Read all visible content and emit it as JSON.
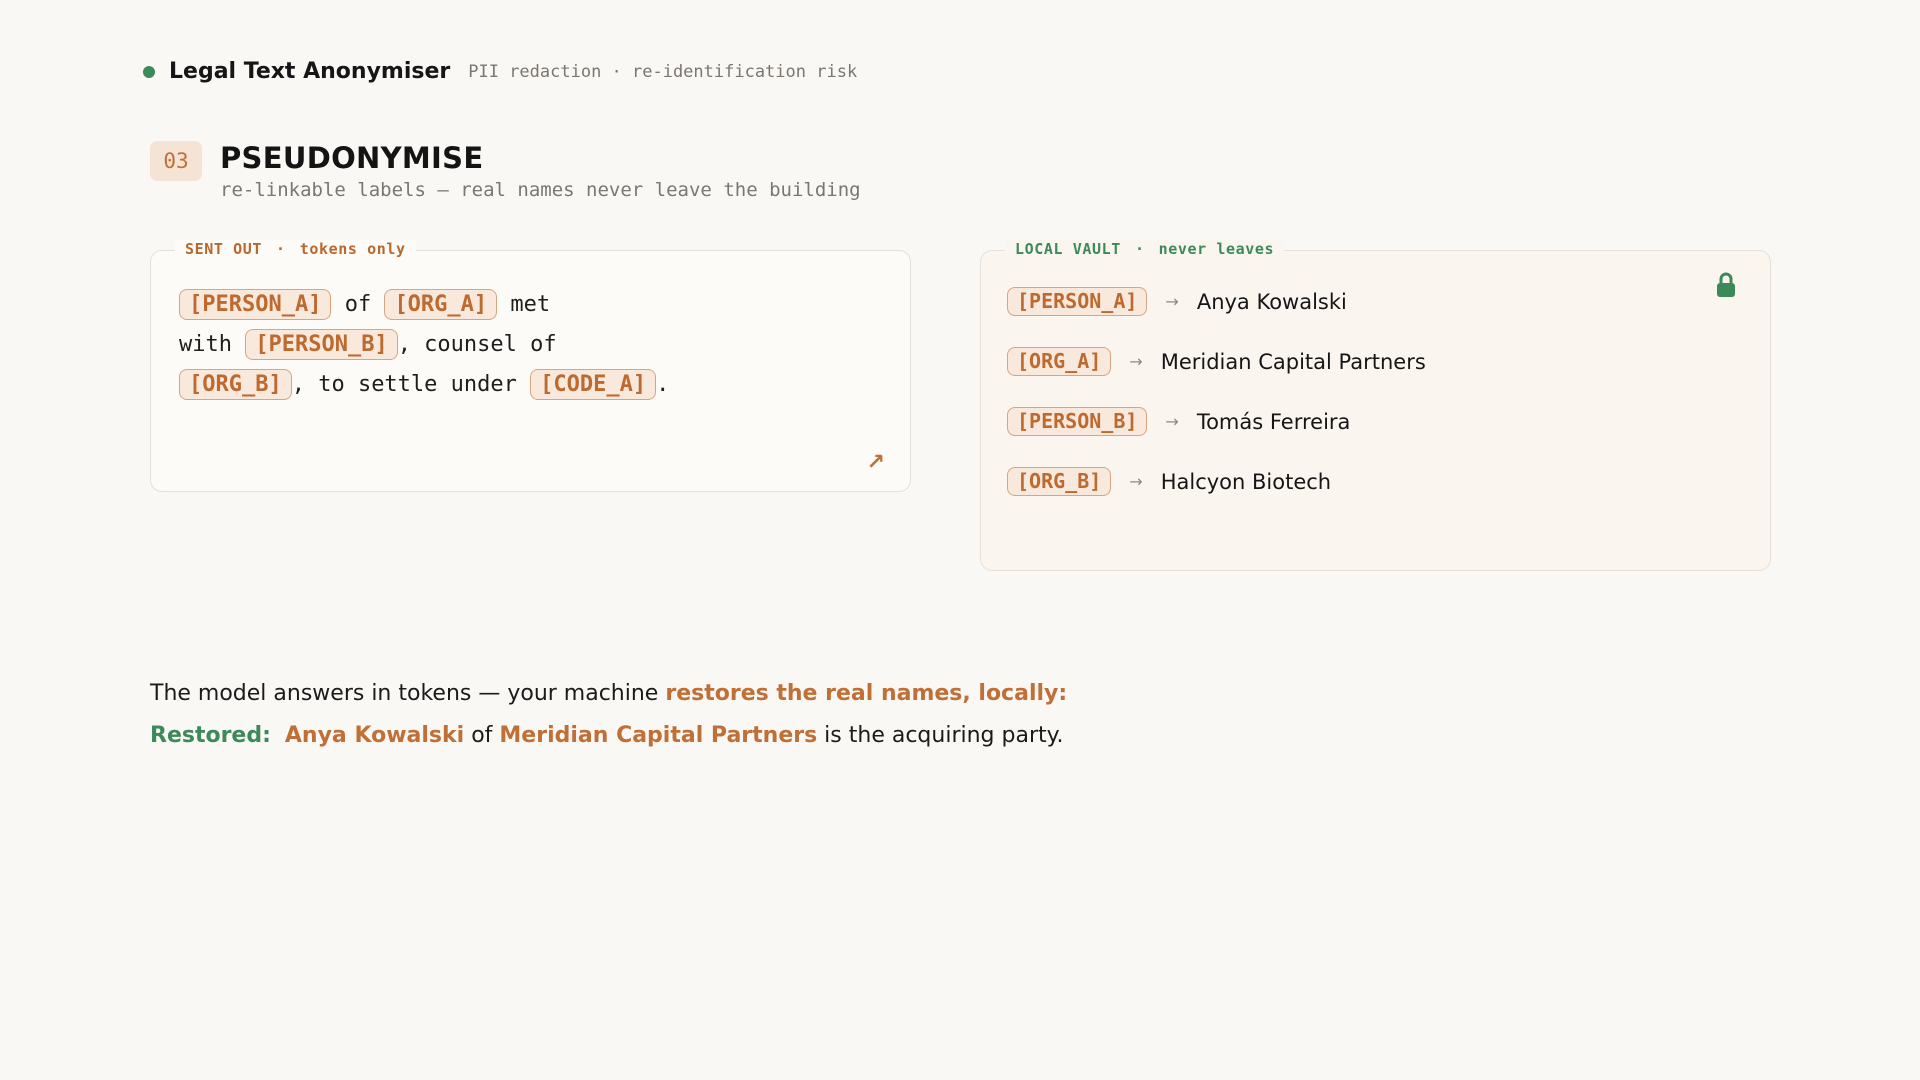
{
  "app": {
    "title": "Legal Text Anonymiser",
    "subtitle": "PII redaction · re-identification risk"
  },
  "step": {
    "number": "03",
    "title": "PSEUDONYMISE",
    "subtitle": "re-linkable labels — real names never leave the building"
  },
  "sent_panel": {
    "label": "SENT OUT",
    "separator": "·",
    "note": "tokens only",
    "text": {
      "line1": {
        "t1": "[PERSON_A]",
        "w1": " of ",
        "t2": "[ORG_A]",
        "w2": " met"
      },
      "line2": {
        "w1": "with ",
        "t1": "[PERSON_B]",
        "w2": ", counsel of"
      },
      "line3": {
        "t1": "[ORG_B]",
        "w1": ", to settle under ",
        "t2": "[CODE_A]",
        "w2": "."
      }
    }
  },
  "vault_panel": {
    "label": "LOCAL VAULT",
    "separator": "·",
    "note": "never leaves",
    "arrow": "→",
    "rows": [
      {
        "token": "[PERSON_A]",
        "name": "Anya Kowalski"
      },
      {
        "token": "[ORG_A]",
        "name": "Meridian Capital Partners"
      },
      {
        "token": "[PERSON_B]",
        "name": "Tomás Ferreira"
      },
      {
        "token": "[ORG_B]",
        "name": "Halcyon Biotech"
      }
    ]
  },
  "answer": {
    "prefix": "The model answers in tokens — your machine ",
    "highlight": "restores the real names, locally:"
  },
  "restored": {
    "label": "Restored:",
    "name1": "Anya Kowalski",
    "mid": " of ",
    "name2": "Meridian Capital Partners",
    "suffix": " is the acquiring party."
  },
  "colors": {
    "accent": "#c06f37",
    "green": "#3c8a5a",
    "background": "#faf8f4"
  },
  "icons": {
    "status": "status-dot",
    "expand": "arrow-up-right-icon",
    "vault": "lock-icon"
  }
}
